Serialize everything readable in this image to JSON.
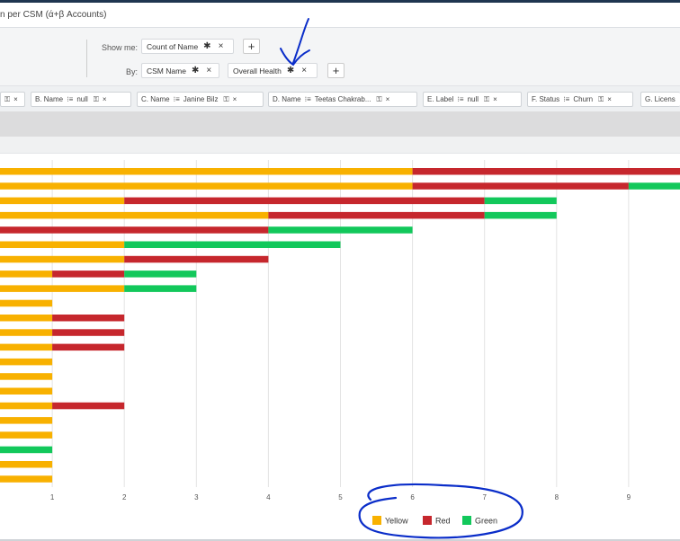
{
  "title": "n per CSM (ά+β Accounts)",
  "config": {
    "show_me_label": "Show me:",
    "by_label": "By:",
    "show_me_pill": "Count of Name",
    "by_pills": [
      "CSM Name",
      "Overall Health"
    ],
    "add_label": "+",
    "remove_label": "×",
    "gear_glyph": "✱"
  },
  "filters": [
    {
      "name": "",
      "op": "",
      "value": ""
    },
    {
      "name": "B. Name",
      "op": "⁝≡",
      "value": "null"
    },
    {
      "name": "C. Name",
      "op": "⁝≡",
      "value": "Janine Bilz"
    },
    {
      "name": "D. Name",
      "op": "⁝≡",
      "value": "Teetas Chakrab..."
    },
    {
      "name": "E. Label",
      "op": "⁝≡",
      "value": "null"
    },
    {
      "name": "F. Status",
      "op": "⁝≡",
      "value": "Churn"
    },
    {
      "name": "G. Licens",
      "op": "",
      "value": ""
    }
  ],
  "filter_icons": {
    "lock": "⚿",
    "close": "×"
  },
  "colors": {
    "yellow": "#f8b100",
    "red": "#c6272d",
    "green": "#12c85b",
    "annotation": "#0a2dc9"
  },
  "chart_data": {
    "type": "bar",
    "orientation": "horizontal",
    "stacked": true,
    "xlim": [
      0,
      9.7
    ],
    "x_ticks": [
      1,
      2,
      3,
      4,
      5,
      6,
      7,
      8,
      9
    ],
    "grid": true,
    "legend_position": "bottom-center",
    "series": [
      {
        "name": "Yellow",
        "color": "#f8b100",
        "values": [
          6,
          6,
          2,
          4,
          0,
          2,
          2,
          1,
          2,
          1,
          1,
          1,
          1,
          1,
          1,
          1,
          1,
          1,
          1,
          0,
          1,
          1
        ]
      },
      {
        "name": "Red",
        "color": "#c6272d",
        "values": [
          4,
          3,
          5,
          3,
          4,
          0,
          2,
          1,
          0,
          0,
          1,
          1,
          1,
          0,
          0,
          0,
          1,
          0,
          0,
          0,
          0,
          0
        ]
      },
      {
        "name": "Green",
        "color": "#12c85b",
        "values": [
          0,
          1,
          1,
          1,
          2,
          3,
          0,
          1,
          1,
          0,
          0,
          0,
          0,
          0,
          0,
          0,
          0,
          0,
          0,
          1,
          0,
          0
        ]
      }
    ]
  }
}
